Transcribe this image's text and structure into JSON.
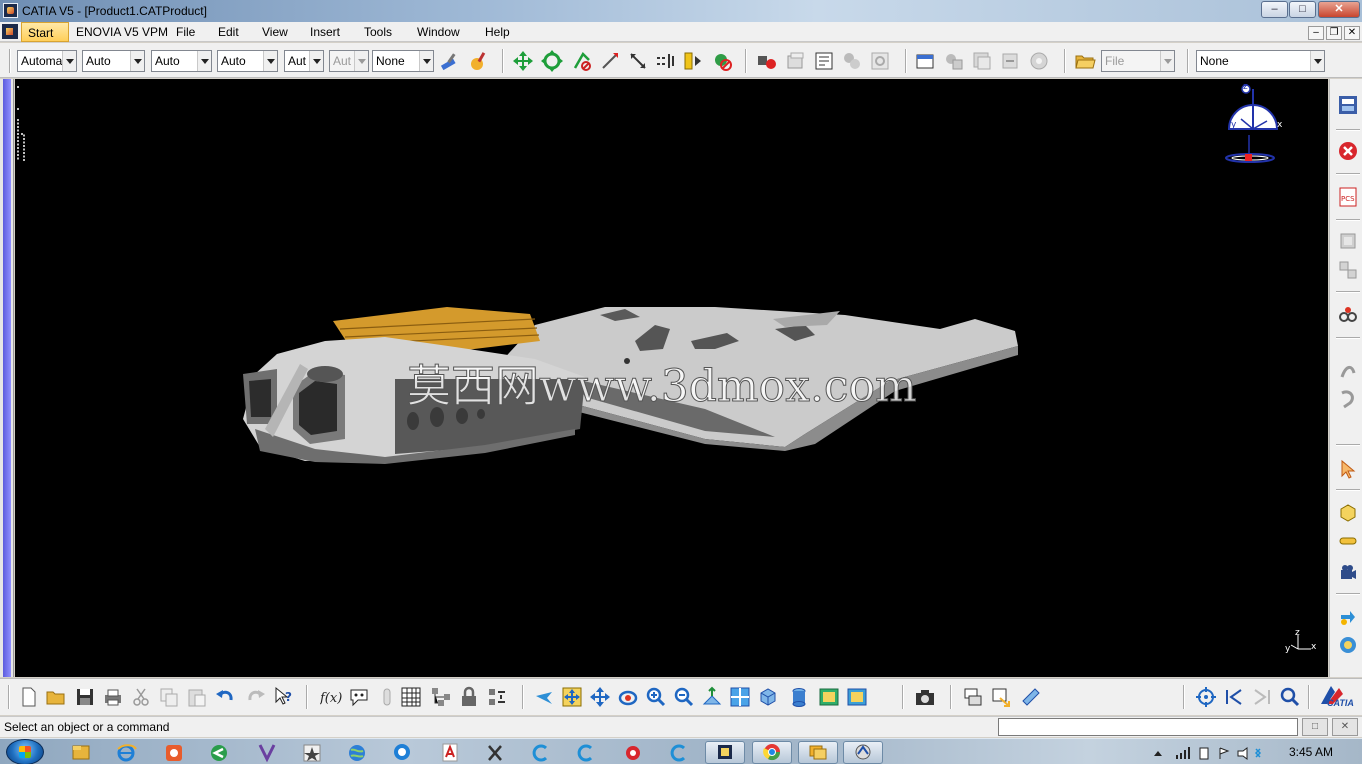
{
  "window": {
    "title": "CATIA V5 - [Product1.CATProduct]",
    "controls": {
      "minimize": "–",
      "maximize": "□",
      "close": "✕"
    }
  },
  "menu": {
    "start": "Start",
    "enovia": "ENOVIA V5 VPM",
    "file": "File",
    "edit": "Edit",
    "view": "View",
    "insert": "Insert",
    "tools": "Tools",
    "window": "Window",
    "help": "Help",
    "doc_controls": {
      "minimize": "–",
      "restore": "❐",
      "close": "✕"
    }
  },
  "toolbar_top": {
    "combos": [
      {
        "value": "Automa"
      },
      {
        "value": "Auto"
      },
      {
        "value": "Auto"
      },
      {
        "value": "Auto"
      },
      {
        "value": "Aut"
      },
      {
        "value": "Aut",
        "disabled": true
      },
      {
        "value": "None"
      }
    ],
    "file_combo": "File",
    "right_combo": "None"
  },
  "viewport": {
    "watermark": "莫西网www.3dmox.com",
    "compass": {
      "x": "x",
      "y": "y",
      "z": "z"
    },
    "axis": {
      "x": "x",
      "y": "y",
      "z": "z"
    },
    "model_colors": {
      "body": "#c9c9c9",
      "shadow": "#6c6c6c",
      "panel": "#d9a236"
    }
  },
  "toolbar_right": {
    "icons": [
      "product-structure-icon",
      "stop-icon",
      "pcs-icon",
      "catalog-icon",
      "constraints-icon",
      "assembly-icon",
      "select-icon",
      "part-icon",
      "sketch-icon",
      "camera-icon",
      "manipulate-icon",
      "analysis-icon"
    ]
  },
  "toolbar_bottom": {
    "brand": "CATIA"
  },
  "status": {
    "message": "Select an object or a command"
  },
  "taskbar": {
    "time": "3:45 AM"
  }
}
